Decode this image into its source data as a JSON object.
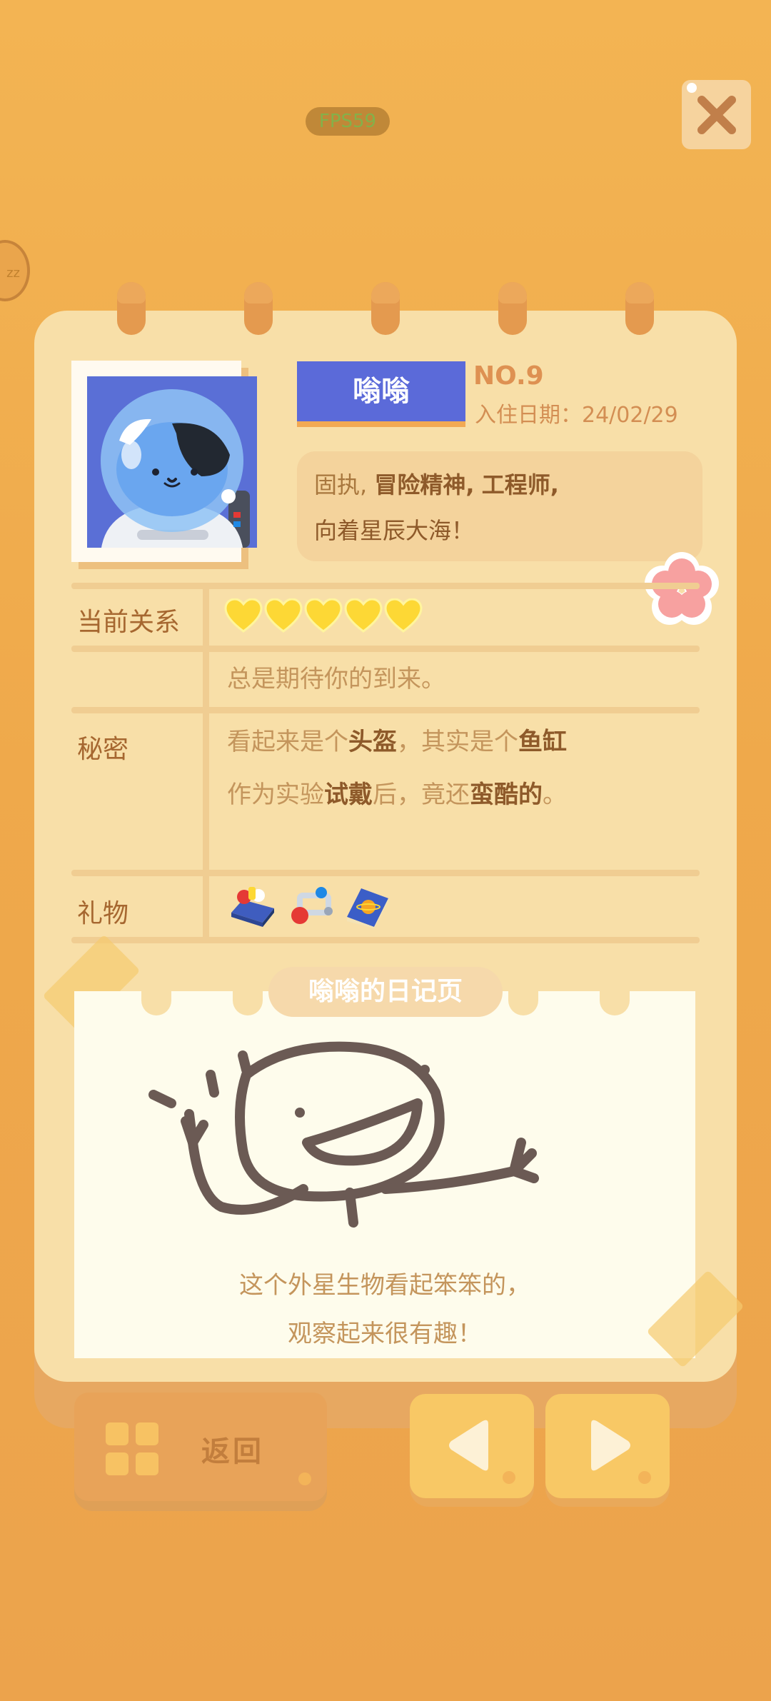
{
  "hud": {
    "fps": "FPS59",
    "side_badge": "zz"
  },
  "profile": {
    "name": "嗡嗡",
    "number": "NO.9",
    "checkin": "入住日期：24/02/29",
    "traits_line1_a": "固执,",
    "traits_line1_b": "冒险精神,",
    "traits_line1_c": "工程师,",
    "traits_line2": "向着星辰大海！"
  },
  "relation": {
    "label": "当前关系",
    "hearts_filled": 5,
    "hearts_total": 5,
    "note": "总是期待你的到来。"
  },
  "secret": {
    "label": "秘密",
    "l1_a": "看起来是个",
    "l1_b": "头盔",
    "l1_c": "，其实是个",
    "l1_d": "鱼缸",
    "l2_a": "作为实验",
    "l2_b": "试戴",
    "l2_c": "后，竟还",
    "l2_d": "蛮酷的",
    "l2_e": "。"
  },
  "gifts": {
    "label": "礼物",
    "items": [
      "toolbox-gift-icon",
      "magnet-gift-icon",
      "space-book-gift-icon"
    ]
  },
  "diary": {
    "title": "嗡嗡的日记页",
    "caption_line1": "这个外星生物看起笨笨的，",
    "caption_line2": "观察起来很有趣！"
  },
  "nav": {
    "back_label": "返回"
  },
  "colors": {
    "accent_blue": "#5b6ad9",
    "paper": "#f8dfa8",
    "background": "#efa94b",
    "heart": "#fdd835"
  }
}
